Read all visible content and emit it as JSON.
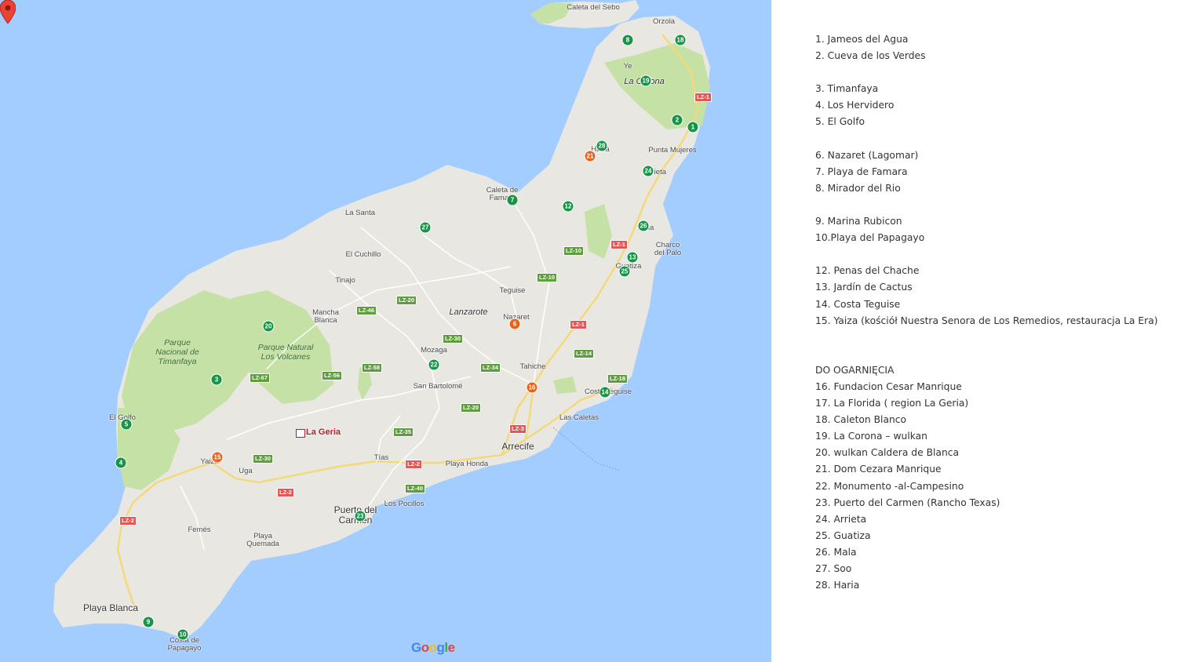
{
  "map": {
    "colors": {
      "sea": "#a3ccff",
      "land": "#e9e7e2",
      "park": "#c5e1a5",
      "road_yellow": "#f4d97a",
      "marker_green": "#179447",
      "marker_orange": "#e8641b"
    },
    "region_label": "Lanzarote",
    "place_labels": [
      "Caleta del Sebo",
      "Orzola",
      "Ye",
      "La Corona",
      "Haría",
      "Punta Mujeres",
      "Arrieta",
      "Caleta de Famara",
      "La Santa",
      "Mala",
      "Charco del Palo",
      "El Cuchillo",
      "Guatiza",
      "Tinajo",
      "Teguise",
      "Mancha Blanca",
      "Nazaret",
      "Mozaga",
      "Tahiche",
      "San Bartolomé",
      "Costa Teguise",
      "El Golfo",
      "Las Caletas",
      "Arrecife",
      "Yaiza",
      "Uga",
      "Tías",
      "Playa Honda",
      "Los Pocillos",
      "Puerto del Carmen",
      "Femés",
      "Playa Quemada",
      "Playa Blanca",
      "Costa de Papagayo"
    ],
    "park_labels": [
      "Parque Nacional de Timanfaya",
      "Parque Natural Los Volcanes"
    ],
    "roads": [
      "LZ-1",
      "LZ-10",
      "LZ-20",
      "LZ-46",
      "LZ-30",
      "LZ-34",
      "LZ-14",
      "LZ-56",
      "LZ-58",
      "LZ-67",
      "LZ-18",
      "LZ-3",
      "LZ-35",
      "LZ-2",
      "LZ-40"
    ],
    "selected_place": "La Geria",
    "markers": [
      {
        "n": "1",
        "color": "green"
      },
      {
        "n": "2",
        "color": "green"
      },
      {
        "n": "3",
        "color": "green"
      },
      {
        "n": "4",
        "color": "green"
      },
      {
        "n": "5",
        "color": "green"
      },
      {
        "n": "6",
        "color": "orange"
      },
      {
        "n": "7",
        "color": "green"
      },
      {
        "n": "8",
        "color": "green"
      },
      {
        "n": "9",
        "color": "green"
      },
      {
        "n": "10",
        "color": "green"
      },
      {
        "n": "12",
        "color": "green"
      },
      {
        "n": "13",
        "color": "green"
      },
      {
        "n": "14",
        "color": "green"
      },
      {
        "n": "15",
        "color": "orange"
      },
      {
        "n": "16",
        "color": "orange"
      },
      {
        "n": "18",
        "color": "green"
      },
      {
        "n": "19",
        "color": "green"
      },
      {
        "n": "20",
        "color": "green"
      },
      {
        "n": "21",
        "color": "orange"
      },
      {
        "n": "22",
        "color": "green"
      },
      {
        "n": "23",
        "color": "green"
      },
      {
        "n": "24",
        "color": "green"
      },
      {
        "n": "25",
        "color": "green"
      },
      {
        "n": "26",
        "color": "green"
      },
      {
        "n": "27",
        "color": "green"
      },
      {
        "n": "28",
        "color": "green"
      }
    ],
    "logo": "Google"
  },
  "legend": {
    "lines": [
      "1. Jameos del Agua",
      "2. Cueva de los Verdes",
      "",
      "3. Timanfaya",
      "4. Los Hervidero",
      "5. El Golfo",
      "",
      "6. Nazaret (Lagomar)",
      "7. Playa de Famara",
      "8. Mirador del Rio",
      "",
      "9. Marina Rubicon",
      "10.Playa del Papagayo",
      "",
      "12. Penas del Chache",
      "13. Jardín de Cactus",
      "14. Costa Teguise",
      "15. Yaiza (kościół Nuestra Senora de Los Remedios, restauracja La Era)",
      "",
      "",
      "DO OGARNIĘCIA",
      "16. Fundacion Cesar Manrique",
      "17. La Florida ( region La Geria)",
      "18. Caleton Blanco",
      "19. La Corona – wulkan",
      "20. wulkan Caldera de Blanca",
      "21. Dom Cezara Manrique",
      "22. Monumento -al-Campesino",
      "23. Puerto del Carmen (Rancho Texas)",
      "24. Arrieta",
      "25. Guatiza",
      "26. Mala",
      "27. Soo",
      "28. Haria"
    ]
  }
}
